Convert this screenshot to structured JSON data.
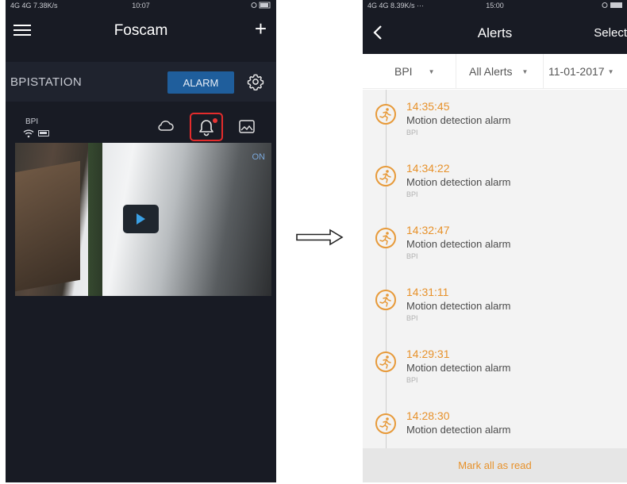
{
  "left_phone": {
    "status": {
      "network": "4G 4G 7.38K/s",
      "time": "10:07"
    },
    "nav": {
      "title": "Foscam",
      "add_label": "+"
    },
    "device": {
      "name": "BPISTATION",
      "alarm_label": "ALARM"
    },
    "camera": {
      "name": "BPI",
      "live_label": "ON"
    }
  },
  "right_phone": {
    "status": {
      "network": "4G 4G 8.39K/s ···",
      "time": "15:00"
    },
    "nav": {
      "title": "Alerts",
      "select_label": "Select"
    },
    "filters": {
      "device": "BPI",
      "type": "All Alerts",
      "date": "11-01-2017"
    },
    "alerts": [
      {
        "time": "14:35:45",
        "text": "Motion detection alarm",
        "device": "BPI"
      },
      {
        "time": "14:34:22",
        "text": "Motion detection alarm",
        "device": "BPI"
      },
      {
        "time": "14:32:47",
        "text": "Motion detection alarm",
        "device": "BPI"
      },
      {
        "time": "14:31:11",
        "text": "Motion detection alarm",
        "device": "BPI"
      },
      {
        "time": "14:29:31",
        "text": "Motion detection alarm",
        "device": "BPI"
      },
      {
        "time": "14:28:30",
        "text": "Motion detection alarm",
        "device": ""
      }
    ],
    "footer": {
      "mark_read_label": "Mark all as read"
    }
  },
  "colors": {
    "accent_orange": "#e7912a",
    "alarm_blue": "#1f5e9c",
    "highlight_red": "#e42c2c",
    "dark_bg": "#181b24"
  }
}
